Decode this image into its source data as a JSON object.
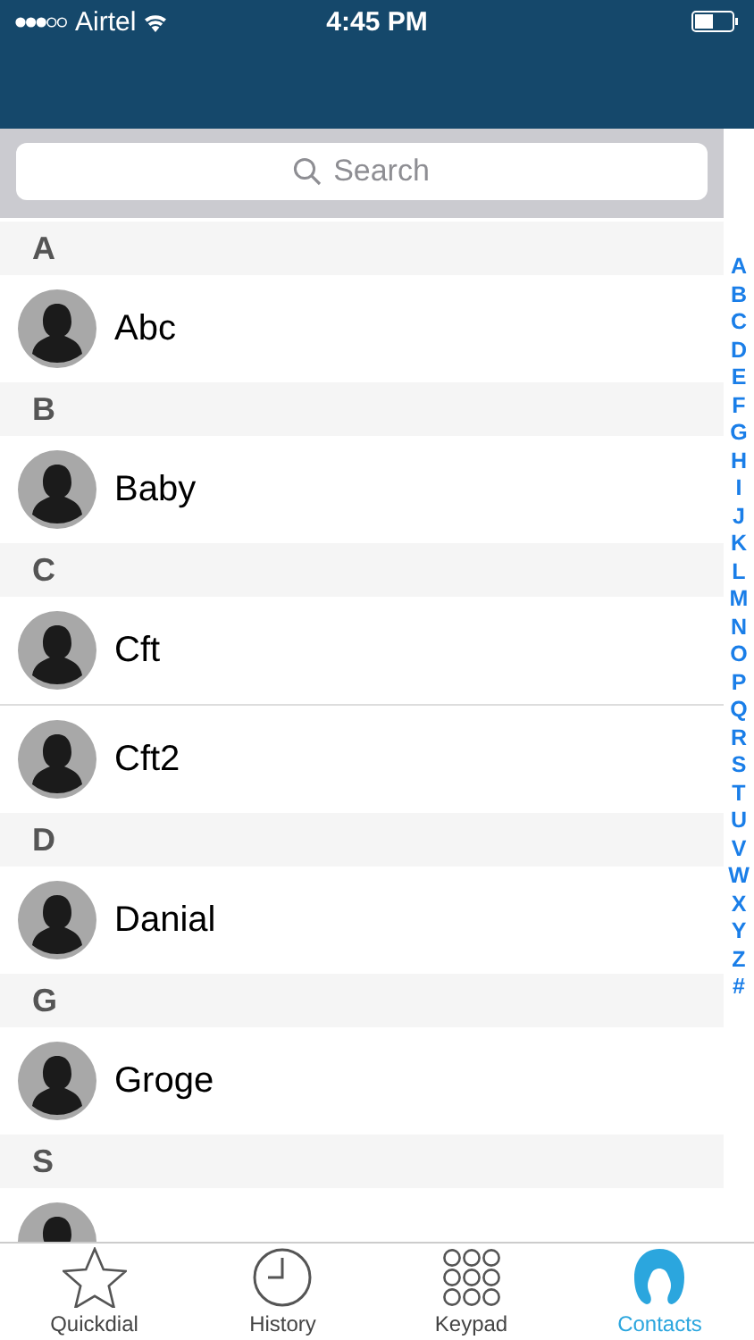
{
  "status_bar": {
    "carrier": "Airtel",
    "time": "4:45 PM"
  },
  "search": {
    "placeholder": "Search"
  },
  "sections": [
    {
      "letter": "A",
      "contacts": [
        "Abc"
      ]
    },
    {
      "letter": "B",
      "contacts": [
        "Baby"
      ]
    },
    {
      "letter": "C",
      "contacts": [
        "Cft",
        "Cft2"
      ]
    },
    {
      "letter": "D",
      "contacts": [
        "Danial"
      ]
    },
    {
      "letter": "G",
      "contacts": [
        "Groge"
      ]
    },
    {
      "letter": "S",
      "cut_off_row": true
    }
  ],
  "index": [
    "A",
    "B",
    "C",
    "D",
    "E",
    "F",
    "G",
    "H",
    "I",
    "J",
    "K",
    "L",
    "M",
    "N",
    "O",
    "P",
    "Q",
    "R",
    "S",
    "T",
    "U",
    "V",
    "W",
    "X",
    "Y",
    "Z",
    "#"
  ],
  "tabs": [
    {
      "label": "Quickdial",
      "kind": "star",
      "selected": false
    },
    {
      "label": "History",
      "kind": "clock",
      "selected": false
    },
    {
      "label": "Keypad",
      "kind": "keypad",
      "selected": false
    },
    {
      "label": "Contacts",
      "kind": "person",
      "selected": true
    }
  ]
}
